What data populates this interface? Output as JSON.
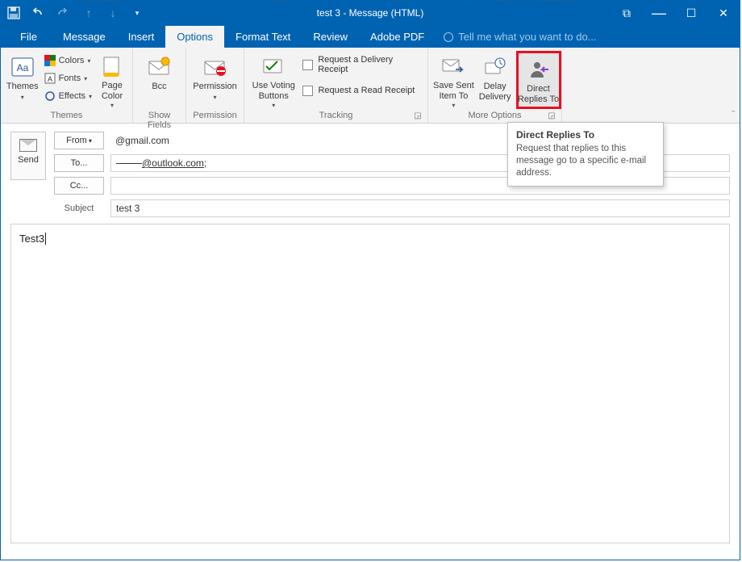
{
  "bg_hints": {
    "h1": "QuickSteps",
    "h2": "Move",
    "h3": "Tags",
    "h4": "Find",
    "h5": "Add-ins",
    "h6": "Send/Receive"
  },
  "window": {
    "title": "test 3 - Message (HTML)",
    "qat": {
      "save": "💾",
      "undo": "↶",
      "redo": "↷"
    }
  },
  "win_controls": {
    "min": "—",
    "max": "☐",
    "close": "✕",
    "popout": "⧉"
  },
  "tabs": {
    "file": "File",
    "message": "Message",
    "insert": "Insert",
    "options": "Options",
    "format_text": "Format Text",
    "review": "Review",
    "adobe_pdf": "Adobe PDF",
    "tell_me": "Tell me what you want to do..."
  },
  "ribbon": {
    "themes": {
      "label": "Themes",
      "themes": "Themes",
      "colors": "Colors",
      "fonts": "Fonts",
      "effects": "Effects",
      "page_color": "Page\nColor"
    },
    "show_fields": {
      "label": "Show Fields",
      "bcc": "Bcc"
    },
    "permission": {
      "label": "Permission",
      "permission": "Permission"
    },
    "tracking": {
      "label": "Tracking",
      "use_voting": "Use Voting\nButtons",
      "req_delivery": "Request a Delivery Receipt",
      "req_read": "Request a Read Receipt"
    },
    "more_options": {
      "label": "More Options",
      "save_sent": "Save Sent\nItem To",
      "delay_delivery": "Delay\nDelivery",
      "direct_replies": "Direct\nReplies To"
    }
  },
  "tooltip": {
    "title": "Direct Replies To",
    "body": "Request that replies to this message go to a specific e-mail address."
  },
  "compose": {
    "send": "Send",
    "from_btn": "From",
    "from_value": "@gmail.com",
    "to_btn": "To...",
    "to_value": "@outlook.com;",
    "cc_btn": "Cc...",
    "cc_value": "",
    "subject_label": "Subject",
    "subject_value": "test 3",
    "body": "Test3"
  }
}
